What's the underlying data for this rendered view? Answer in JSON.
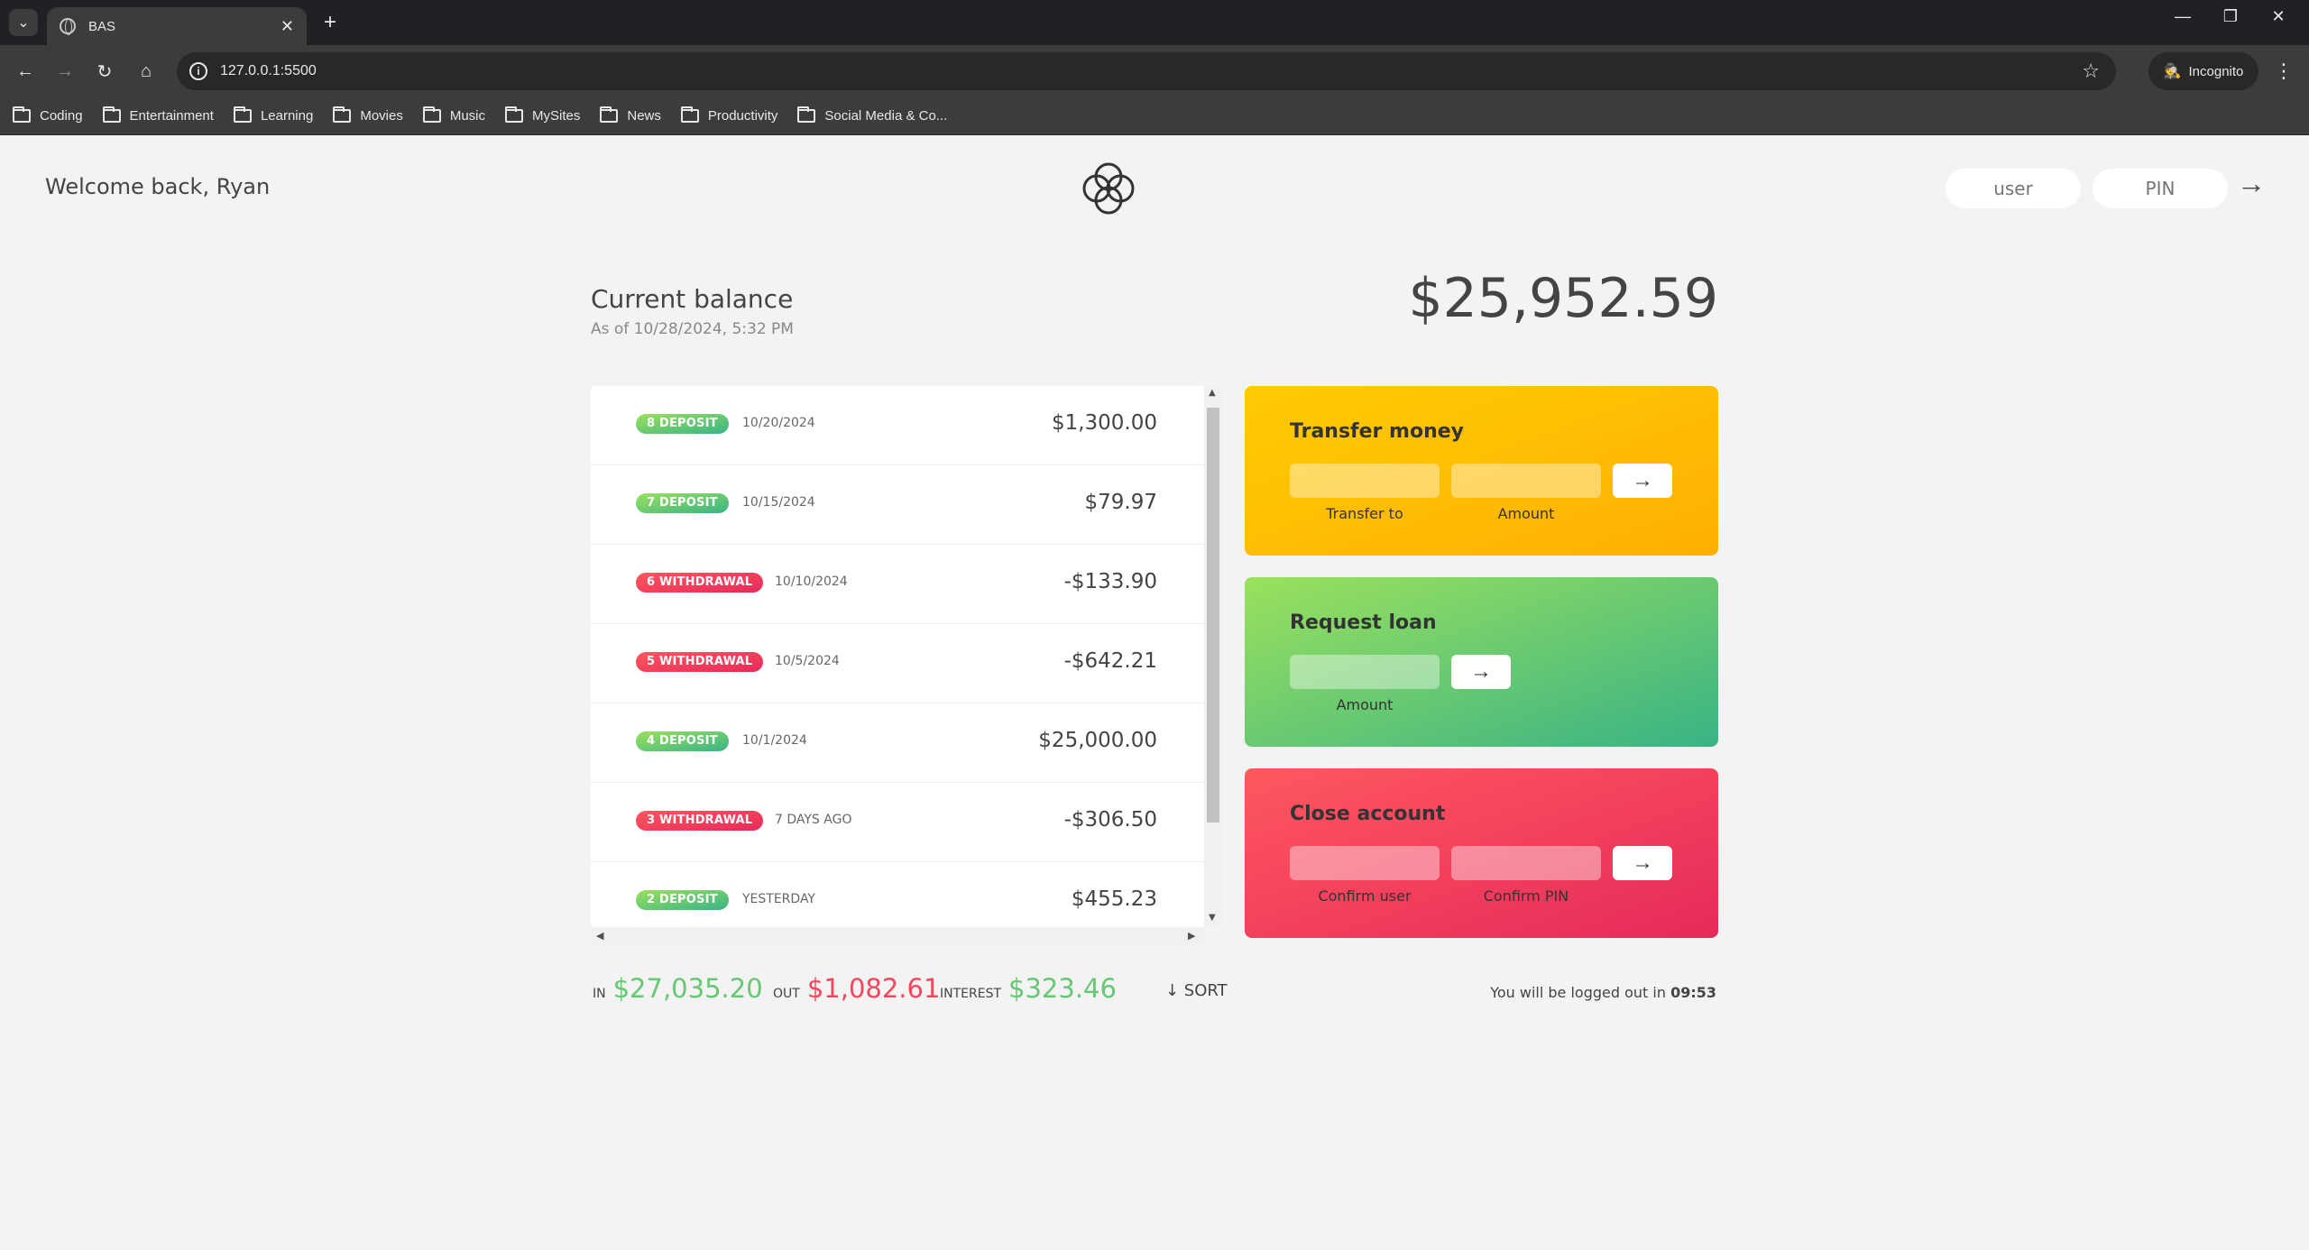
{
  "browser": {
    "tab_title": "BAS",
    "tab_close": "✕",
    "new_tab": "+",
    "url": "127.0.0.1:5500",
    "incognito_label": "Incognito",
    "bookmarks": [
      "Coding",
      "Entertainment",
      "Learning",
      "Movies",
      "Music",
      "MySites",
      "News",
      "Productivity",
      "Social Media & Co..."
    ]
  },
  "header": {
    "welcome": "Welcome back, Ryan",
    "user_placeholder": "user",
    "pin_placeholder": "PIN",
    "login_arrow": "→"
  },
  "balance": {
    "label": "Current balance",
    "date": "As of 10/28/2024, 5:32 PM",
    "value": "$25,952.59"
  },
  "movements": [
    {
      "type": "8 deposit",
      "kind": "deposit",
      "date": "10/20/2024",
      "value": "$1,300.00"
    },
    {
      "type": "7 deposit",
      "kind": "deposit",
      "date": "10/15/2024",
      "value": "$79.97"
    },
    {
      "type": "6 withdrawal",
      "kind": "withdrawal",
      "date": "10/10/2024",
      "value": "-$133.90"
    },
    {
      "type": "5 withdrawal",
      "kind": "withdrawal",
      "date": "10/5/2024",
      "value": "-$642.21"
    },
    {
      "type": "4 deposit",
      "kind": "deposit",
      "date": "10/1/2024",
      "value": "$25,000.00"
    },
    {
      "type": "3 withdrawal",
      "kind": "withdrawal",
      "date": "7 days ago",
      "value": "-$306.50"
    },
    {
      "type": "2 deposit",
      "kind": "deposit",
      "date": "Yesterday",
      "value": "$455.23"
    }
  ],
  "operations": {
    "transfer": {
      "title": "Transfer money",
      "label_to": "Transfer to",
      "label_amount": "Amount",
      "button": "→"
    },
    "loan": {
      "title": "Request loan",
      "label_amount": "Amount",
      "button": "→"
    },
    "close": {
      "title": "Close account",
      "label_user": "Confirm user",
      "label_pin": "Confirm PIN",
      "button": "→"
    }
  },
  "summary": {
    "in_label": "In",
    "in_value": "$27,035.20",
    "out_label": "Out",
    "out_value": "$1,082.61",
    "interest_label": "Interest",
    "interest_value": "$323.46",
    "sort_label": "↓ SORT"
  },
  "logout": {
    "text": "You will be logged out in ",
    "timer": "09:53"
  },
  "colors": {
    "deposit": "#66c873",
    "withdrawal": "#f5465d",
    "transfer_gradient": [
      "#ffb003",
      "#ffcb03"
    ],
    "loan_gradient": [
      "#39b385",
      "#9be15d"
    ],
    "close_gradient": [
      "#e52a5a",
      "#ff585f"
    ]
  }
}
